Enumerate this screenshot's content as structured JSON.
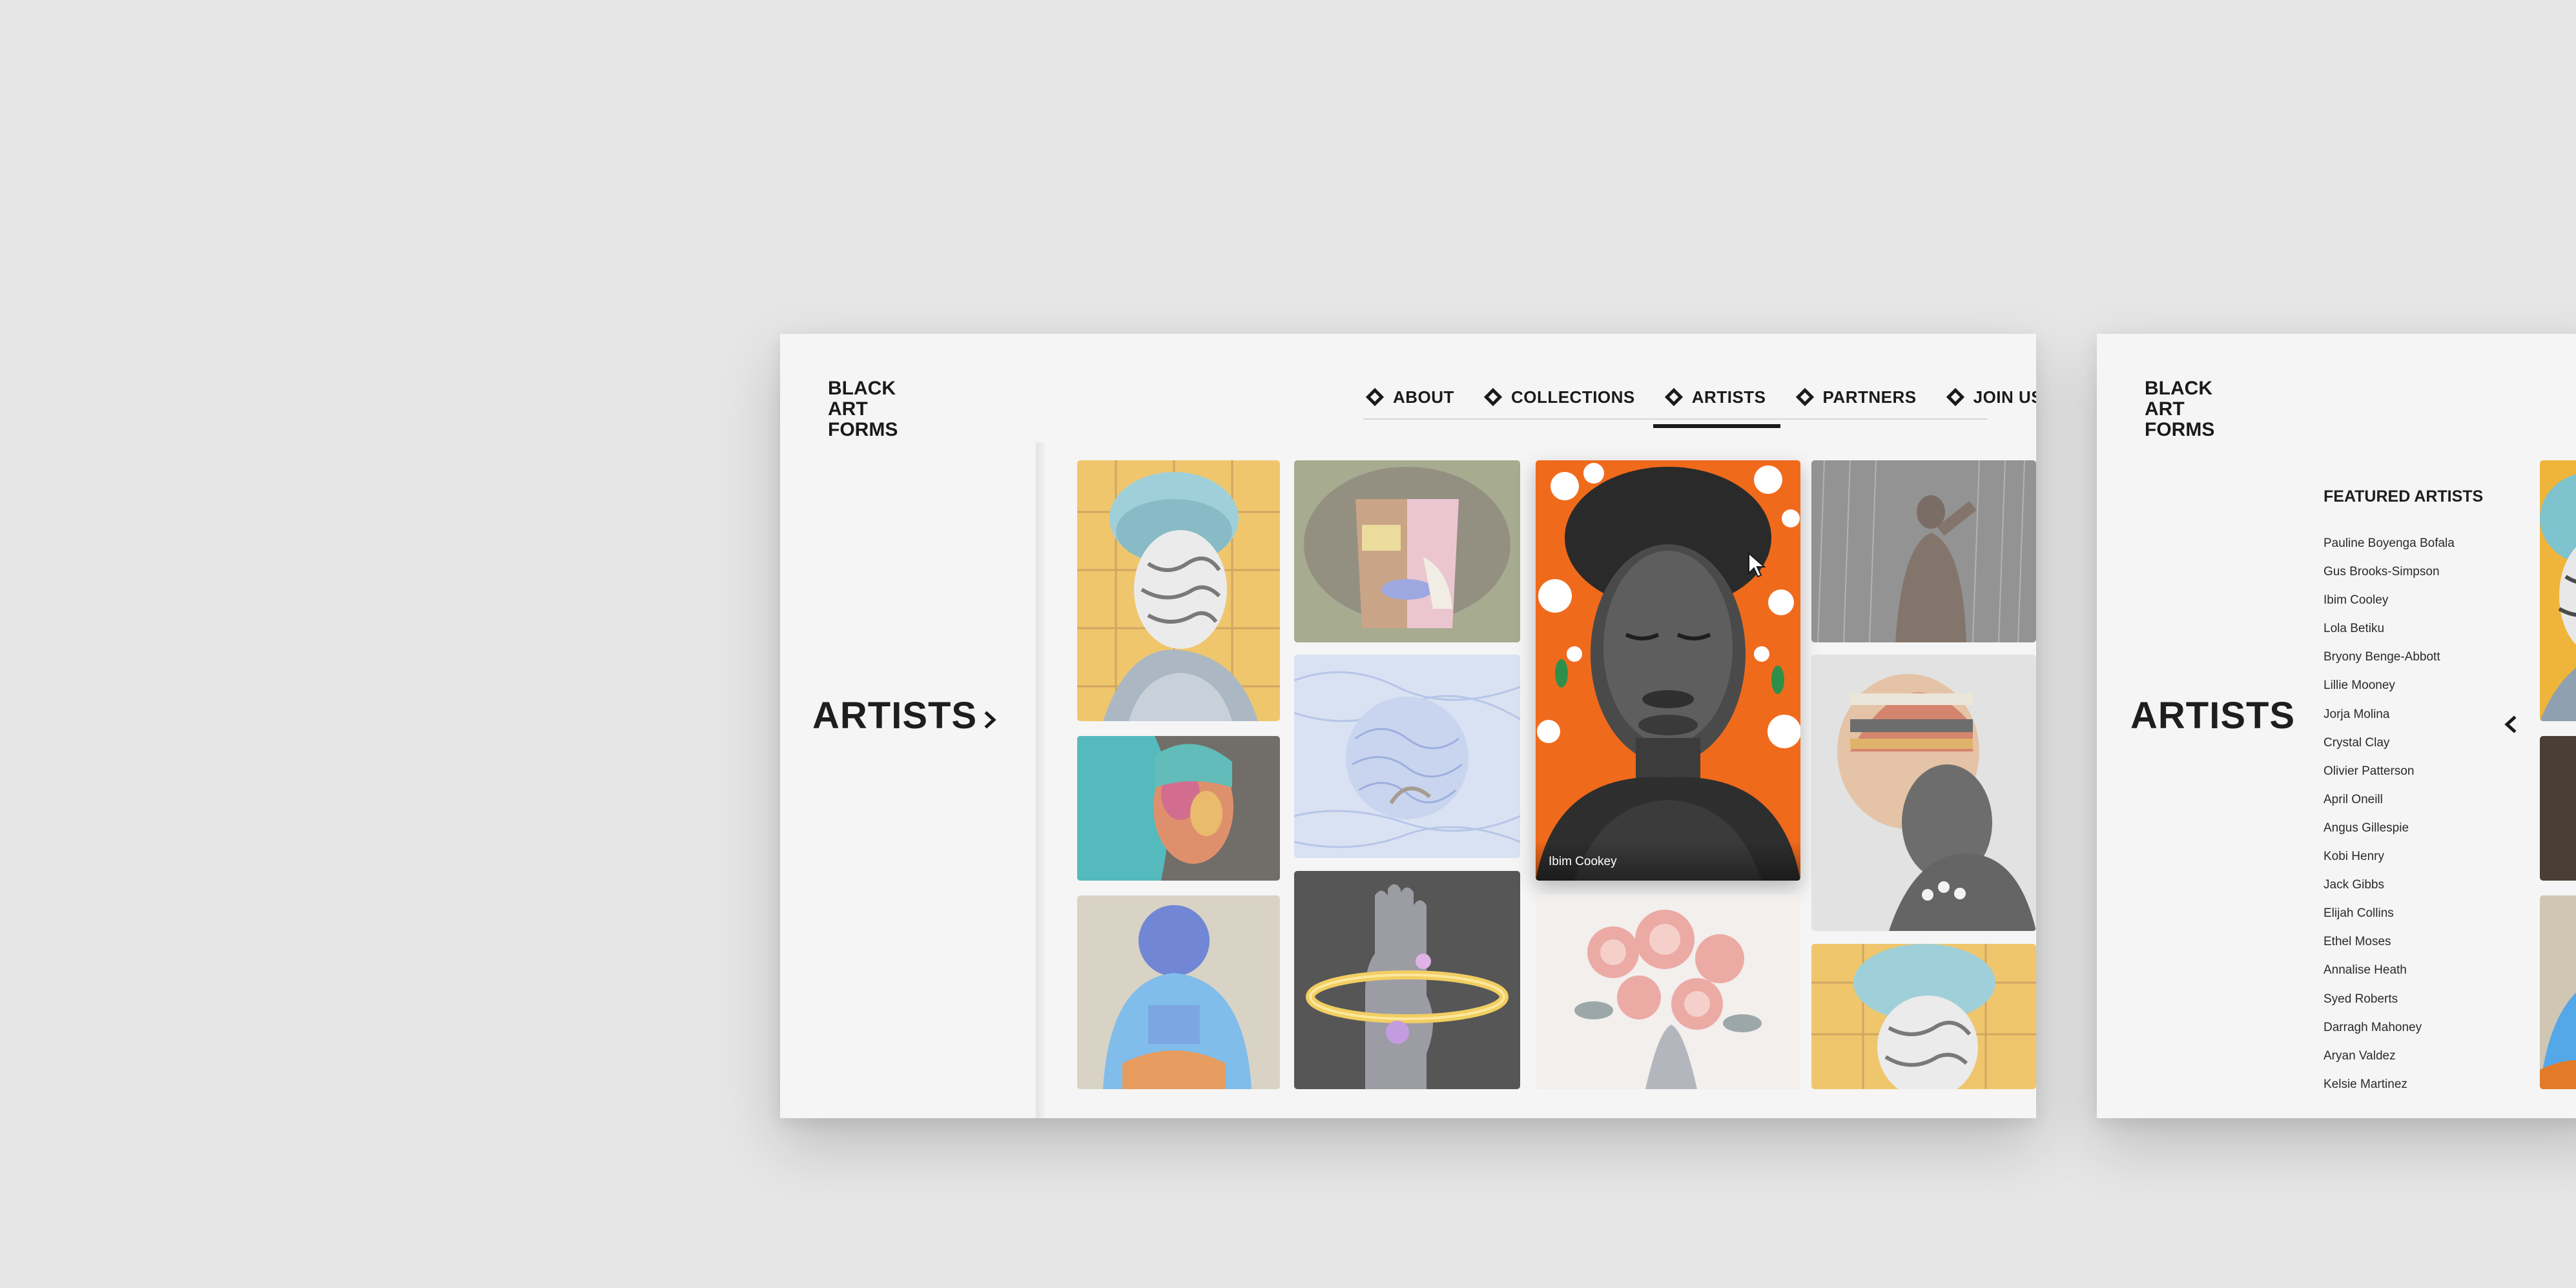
{
  "brand": {
    "logo_lines": [
      "BLACK",
      "ART",
      "FORMS"
    ]
  },
  "nav": {
    "items": [
      {
        "label": "ABOUT"
      },
      {
        "label": "COLLECTIONS"
      },
      {
        "label": "ARTISTS",
        "active": true
      },
      {
        "label": "PARTNERS"
      },
      {
        "label": "JOIN US"
      }
    ]
  },
  "gallery": {
    "section_title": "ARTISTS",
    "featured_caption": "Ibim Cookey"
  },
  "panel": {
    "section_title": "ARTISTS",
    "featured_heading": "FEATURED ARTISTS",
    "featured_artists": [
      "Pauline Boyenga Bofala",
      "Gus Brooks-Simpson",
      "Ibim Cooley",
      "Lola Betiku",
      "Bryony Benge-Abbott",
      "Lillie Mooney",
      "Jorja Molina",
      "Crystal Clay",
      "Olivier Patterson",
      "April Oneill",
      "Angus Gillespie",
      "Kobi Henry",
      "Jack Gibbs",
      "Elijah Collins",
      "Ethel Moses",
      "Annalise Heath",
      "Syed Roberts",
      "Darragh Mahoney",
      "Aryan Valdez",
      "Kelsie Martinez"
    ]
  },
  "icons": {
    "expand": "chevron-right-icon",
    "collapse": "chevron-left-icon",
    "nav_marker": "diamond-icon",
    "pointer": "mouse-cursor-icon"
  },
  "colors": {
    "page_bg": "#e6e6e6",
    "card_bg": "#f5f5f5",
    "ink": "#1a1a1a",
    "accent_orange": "#f06a1c",
    "accent_yellow": "#f2b531"
  }
}
